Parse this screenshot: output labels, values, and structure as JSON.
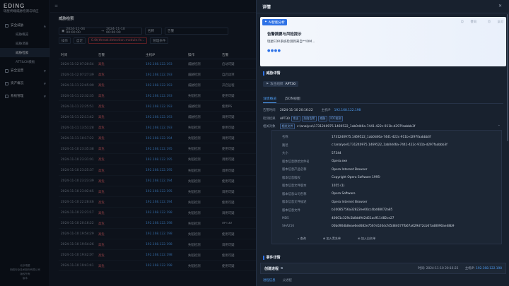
{
  "sidebar": {
    "brand_logo": "EDING",
    "brand_subtitle": "瑞星终端威胁检测与响应",
    "groups": [
      {
        "label": "安全威胁",
        "expanded": true
      },
      {
        "label": "安全运营",
        "expanded": false
      },
      {
        "label": "资产概况",
        "expanded": false
      },
      {
        "label": "系统管理",
        "expanded": false
      }
    ],
    "items": [
      {
        "label": "威胁概览",
        "active": false
      },
      {
        "label": "威胁调查",
        "active": false
      },
      {
        "label": "威胁检索",
        "active": true
      },
      {
        "label": "ATT&CK模板",
        "active": false
      }
    ],
    "footer": [
      "北京瑞星",
      "网络安全技术股份有限公司",
      "版权所有",
      "版本"
    ]
  },
  "main": {
    "page_tab": "威胁检索",
    "date_start": "2024-11-04 00:00:00",
    "date_end": "2024-11-10 00:00:00",
    "filter_field": "名称",
    "filter_value": "告警",
    "tag_label": "0.0t(threat.detection.module.fe...",
    "btn_export": "操作",
    "btn_custom": "自定",
    "btn_manage": "管理条件",
    "table_columns": [
      "时间",
      "告警",
      "主机IP",
      "操作",
      "告警"
    ],
    "rows": [
      {
        "time": "2024-11-12 07:20:54",
        "level": "高危",
        "ip": "192.168.122.193",
        "op": "威胁检测",
        "name": "启动可疑"
      },
      {
        "time": "2024-11-12 07:27:39",
        "level": "高危",
        "ip": "192.168.122.193",
        "op": "威胁检测",
        "name": "自启动项"
      },
      {
        "time": "2024-11-11 22:45:09",
        "level": "高危",
        "ip": "192.168.122.193",
        "op": "威胁检测",
        "name": "开启远程"
      },
      {
        "time": "2024-11-11 22:32:35",
        "level": "高危",
        "ip": "192.168.122.193",
        "op": "失陷检测",
        "name": "使用可疑"
      },
      {
        "time": "2024-11-11 22:25:51",
        "level": "高危",
        "ip": "192.168.122.193",
        "op": "威胁检测",
        "name": "使用PS"
      },
      {
        "time": "2024-11-11 22:11:42",
        "level": "高危",
        "ip": "192.168.122.193",
        "op": "威胁检测",
        "name": "调用可疑"
      },
      {
        "time": "2024-11-11 13:51:28",
        "level": "高危",
        "ip": "192.168.122.193",
        "op": "失陷检测",
        "name": "使用可疑"
      },
      {
        "time": "2024-11-11 10:17:22",
        "level": "高危",
        "ip": "192.168.122.194",
        "op": "失陷检测",
        "name": "调用可疑"
      },
      {
        "time": "2024-11-10 23:35:38",
        "level": "高危",
        "ip": "192.168.122.195",
        "op": "失陷检测",
        "name": "使用可疑"
      },
      {
        "time": "2024-11-10 23:31:01",
        "level": "高危",
        "ip": "192.168.122.195",
        "op": "失陷检测",
        "name": "调用可疑"
      },
      {
        "time": "2024-11-10 23:25:37",
        "level": "高危",
        "ip": "192.168.122.195",
        "op": "失陷检测",
        "name": "调用可疑"
      },
      {
        "time": "2024-11-10 23:23:39",
        "level": "高危",
        "ip": "192.168.122.194",
        "op": "失陷检测",
        "name": "使用可疑"
      },
      {
        "time": "2024-11-10 23:02:45",
        "level": "高危",
        "ip": "192.168.122.195",
        "op": "失陷检测",
        "name": "调用可疑"
      },
      {
        "time": "2024-11-10 22:28:46",
        "level": "高危",
        "ip": "192.168.122.194",
        "op": "失陷检测",
        "name": "使用可疑"
      },
      {
        "time": "2024-11-10 22:21:17",
        "level": "高危",
        "ip": "192.168.122.198",
        "op": "失陷检测",
        "name": "调用可疑"
      },
      {
        "time": "2024-11-10 20:16:22",
        "level": "高危",
        "ip": "192.168.122.198",
        "op": "失陷检测",
        "name": "APT30"
      },
      {
        "time": "2024-11-10 19:54:29",
        "level": "高危",
        "ip": "192.168.122.198",
        "op": "失陷检测",
        "name": "使用可疑"
      },
      {
        "time": "2024-11-10 19:54:26",
        "level": "高危",
        "ip": "192.168.122.198",
        "op": "失陷检测",
        "name": "调用可疑"
      },
      {
        "time": "2024-11-10 19:42:07",
        "level": "高危",
        "ip": "192.168.122.198",
        "op": "失陷检测",
        "name": "使用可疑"
      },
      {
        "time": "2024-11-10 19:41:41",
        "level": "高危",
        "ip": "192.168.122.198",
        "op": "失陷检测",
        "name": "使用可疑"
      }
    ]
  },
  "drawer": {
    "title": "详情",
    "ai": {
      "badge": "AI智能分析",
      "action_like": "赞同",
      "action_dislike": "反对",
      "heading": "告警摘要与风险提示",
      "text": "瑞星EDR系统检测到来自**IOM..."
    },
    "threat_section": "威胁详情",
    "org_label": "攻击组织",
    "org_value": "APT30",
    "tabs": [
      "详情概览",
      "JSON视图"
    ],
    "fields": {
      "time_label": "告警时间",
      "time_value": "2024-11-10 20:16:22",
      "host_label": "主机IP",
      "host_value": "192.168.122.198",
      "detect_label": "检测结果",
      "detect_value": "APT30",
      "detect_chips": [
        "攻击",
        "失陷告警",
        "威胁",
        "IOC检测"
      ],
      "target_label": "相关对象",
      "target_chip": "相关文件",
      "target_value": "c:\\analyse\\1731240975.1469522_1ab0d46a-7441-422c-911b-d297faabbb3f"
    },
    "file_rows": [
      {
        "k": "名称",
        "v": "1731240975.1469522_1ab0d46a-7441-422c-911b-d297faabbb3f"
      },
      {
        "k": "路径",
        "v": "c:\\analyse\\1731240975.1469522_1ab0d46a-7441-422c-911b-d297faabbb3f"
      },
      {
        "k": "大小",
        "v": "57344"
      },
      {
        "k": "版本信息原始文件名",
        "v": "Opera.exe"
      },
      {
        "k": "版本信息产品名称",
        "v": "Opera Internet Browser"
      },
      {
        "k": "版本信息版权",
        "v": "Copyright Opera Software 1995-"
      },
      {
        "k": "版本信息文件版本",
        "v": "1055 (1)"
      },
      {
        "k": "版本信息公司名称",
        "v": "Opera Software"
      },
      {
        "k": "版本信息文件描述",
        "v": "Opera Internet Browser"
      },
      {
        "k": "版本信息文件",
        "v": "b10085756a32822ee00cc4bd48072a85"
      },
      {
        "k": "MD5",
        "v": "40601c329c5b8dd942d51ac911482ce27"
      },
      {
        "k": "SHA256",
        "v": "00bd90db8eae6ed682e7567e520dcf45d84077fb67a629d72cb67ad8090ae48b9"
      }
    ],
    "file_buttons": [
      "查询",
      "加入黑名单",
      "加入白名单"
    ],
    "event_section": "事件详情",
    "process_title": "创建进程",
    "process_time_label": "时间:",
    "process_time": "2024-11-10 20:16:22",
    "process_host_label": "主机IP:",
    "process_host": "192.168.122.198",
    "bottom_tabs": [
      "进程信息",
      "父进程"
    ]
  }
}
